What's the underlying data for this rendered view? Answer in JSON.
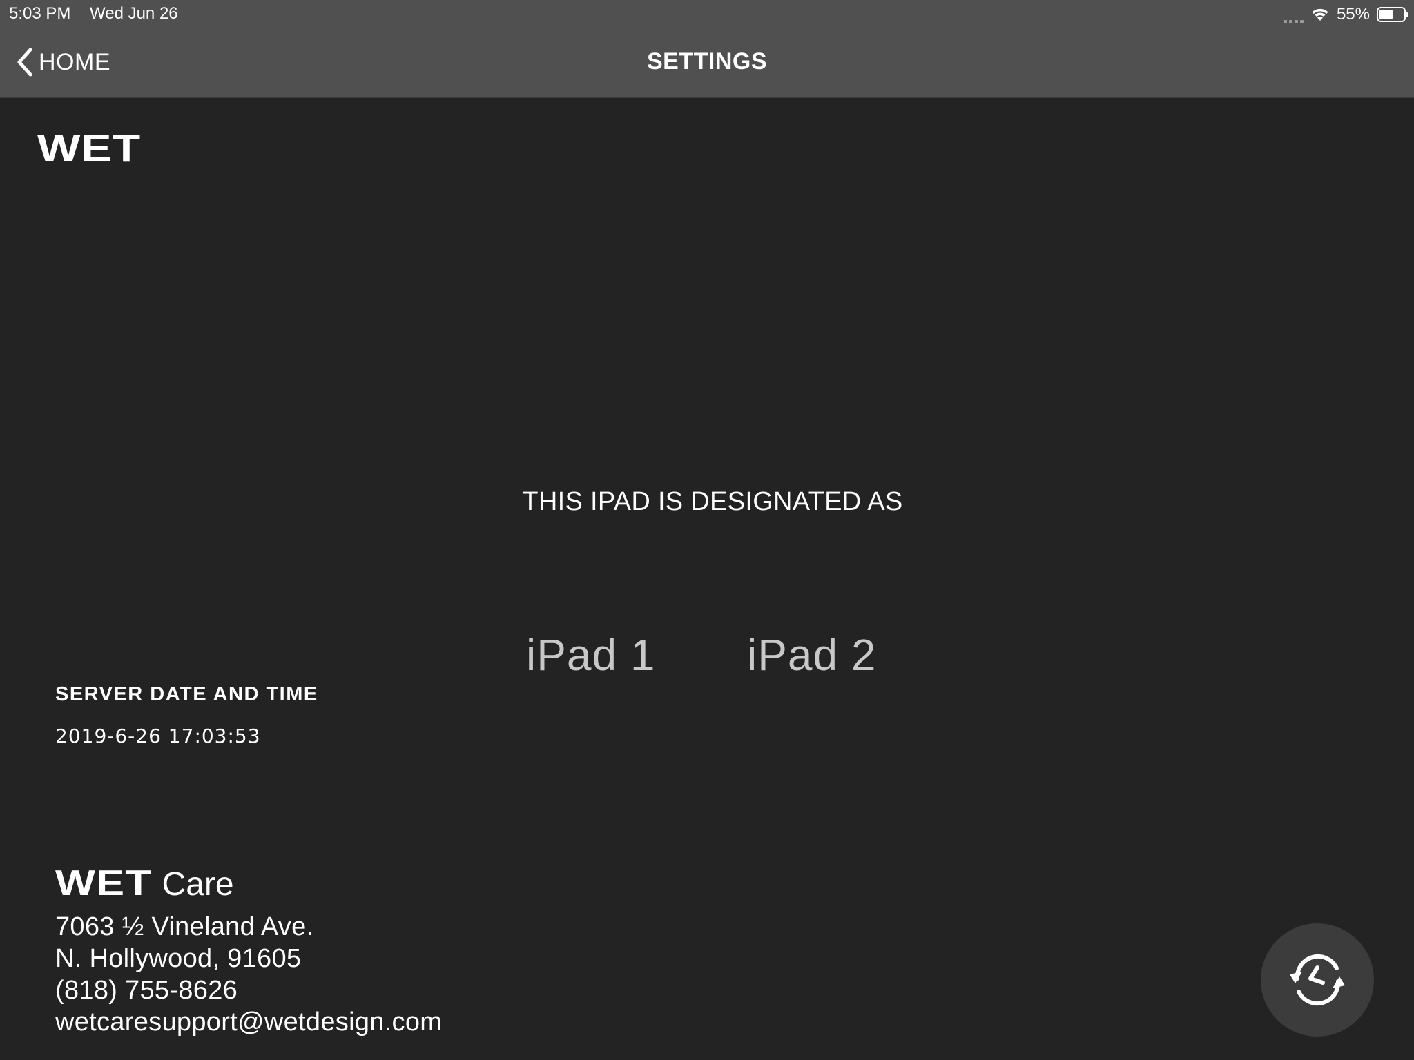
{
  "status_bar": {
    "time": "5:03 PM",
    "date": "Wed Jun 26",
    "battery_percent": "55%",
    "battery_level": 0.55,
    "icons": [
      "cellular-signal-icon",
      "wifi-icon",
      "battery-icon"
    ]
  },
  "nav": {
    "back_label": "HOME",
    "title": "SETTINGS"
  },
  "brand": {
    "logo_text": "WET"
  },
  "designation": {
    "heading": "THIS IPAD IS DESIGNATED AS",
    "options": [
      "iPad 1",
      "iPad 2"
    ]
  },
  "server": {
    "label": "SERVER DATE AND TIME",
    "value": "2019-6-26 17:03:53"
  },
  "care": {
    "logo_text": "WET",
    "word": "Care",
    "address_line1": "7063 ½ Vineland Ave.",
    "address_line2": "N. Hollywood, 91605",
    "phone": "(818) 755-8626",
    "email": "wetcaresupport@wetdesign.com"
  },
  "actions": {
    "refresh_icon": "refresh-clock-icon"
  },
  "colors": {
    "background": "#232323",
    "header": "#505050",
    "option_text": "#c8c8c8",
    "button_bg": "#3c3c3c"
  }
}
